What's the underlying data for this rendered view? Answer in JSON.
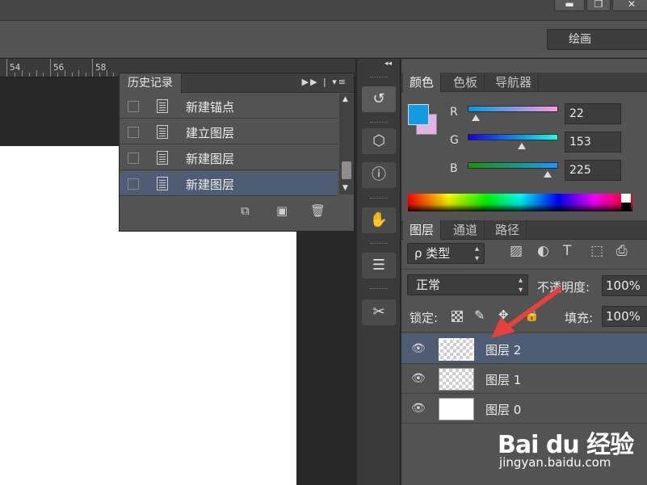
{
  "window": {
    "controls": [
      "▬",
      "❐",
      "✕"
    ]
  },
  "options_bar": {
    "workspace": "绘画"
  },
  "ruler": {
    "labels": [
      "54",
      "56",
      "58"
    ]
  },
  "history_panel": {
    "title": "历史记录",
    "controls": "▶▶ | ▾≡",
    "items": [
      {
        "label": "新建锚点"
      },
      {
        "label": "建立图层"
      },
      {
        "label": "新建图层"
      },
      {
        "label": "新建图层",
        "selected": true
      }
    ],
    "footer_icons": [
      "new-document-from-state-icon",
      "camera-snapshot-icon",
      "trash-icon"
    ]
  },
  "tools": {
    "collapse_glyph": "◂◂",
    "buttons": [
      {
        "name": "history-panel-icon",
        "glyph": "↺"
      },
      {
        "name": "3d-cube-icon",
        "glyph": "⬡"
      },
      {
        "name": "info-icon",
        "glyph": "ⓘ"
      },
      {
        "name": "brush-presets-icon",
        "glyph": "✋"
      },
      {
        "name": "paragraph-icon",
        "glyph": "☰"
      },
      {
        "name": "tool-presets-icon",
        "glyph": "✂"
      }
    ]
  },
  "color_panel": {
    "tabs": [
      "颜色",
      "色板",
      "导航器"
    ],
    "active_tab": "颜色",
    "foreground": "#1699e1",
    "background": "#e4b2e4",
    "channels": [
      {
        "label": "R",
        "value": "22",
        "fraction": 0.086
      },
      {
        "label": "G",
        "value": "153",
        "fraction": 0.6
      },
      {
        "label": "B",
        "value": "225",
        "fraction": 0.882
      }
    ]
  },
  "layers_panel": {
    "tabs": [
      "图层",
      "通道",
      "路径"
    ],
    "active_tab": "图层",
    "filter_label": "ρ 类型",
    "filter_icons": [
      "image-filter-icon",
      "adjustment-filter-icon",
      "type-filter-icon",
      "shape-filter-icon",
      "smart-object-filter-icon"
    ],
    "blend_mode": "正常",
    "opacity_label": "不透明度:",
    "opacity_value": "100%",
    "lock_label": "锁定:",
    "fill_label": "填充:",
    "fill_value": "100%",
    "layers": [
      {
        "name": "图层 2",
        "thumb": "transparent",
        "selected": true
      },
      {
        "name": "图层 1",
        "thumb": "transparent",
        "selected": false
      },
      {
        "name": "图层 0",
        "thumb": "white",
        "selected": false
      }
    ]
  },
  "watermark": {
    "logo": "Bai du 经验",
    "url": "jingyan.baidu.com"
  }
}
